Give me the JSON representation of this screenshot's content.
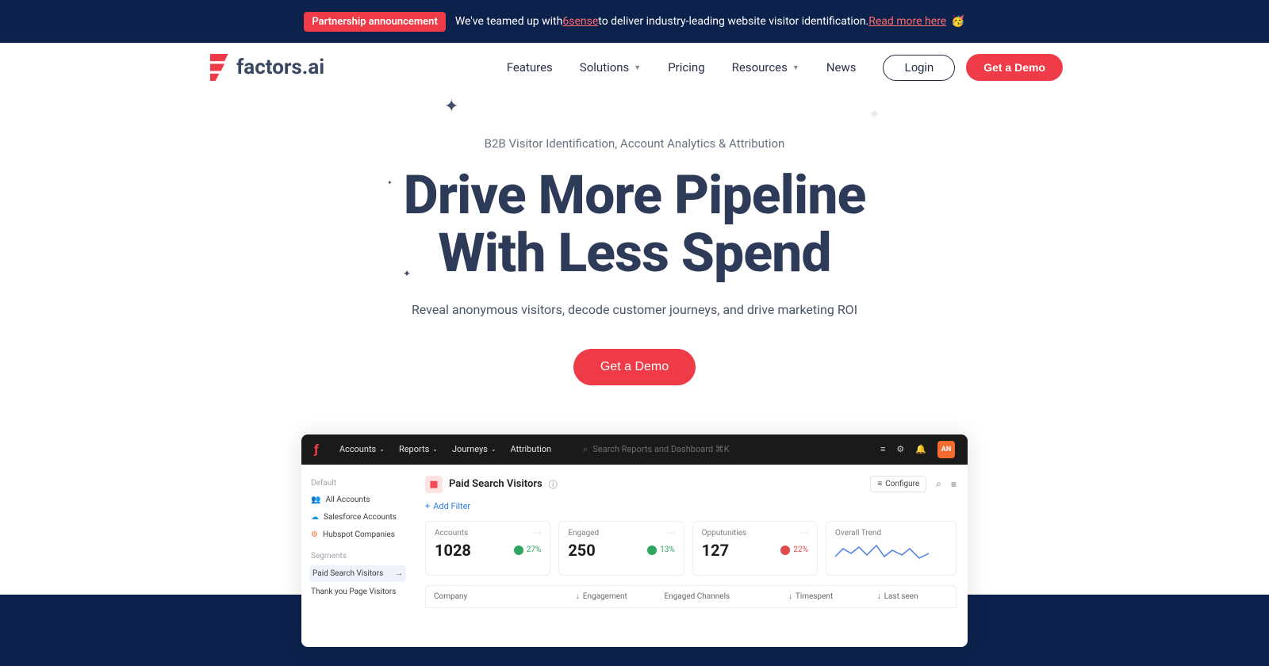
{
  "announcement": {
    "badge": "Partnership announcement",
    "text_pre": "We've teamed up with ",
    "partner": "6sense",
    "text_post": " to deliver industry-leading website visitor identification. ",
    "link": "Read more here",
    "emoji": "🥳"
  },
  "brand": "factors.ai",
  "nav": {
    "features": "Features",
    "solutions": "Solutions",
    "pricing": "Pricing",
    "resources": "Resources",
    "news": "News",
    "login": "Login",
    "demo": "Get a Demo"
  },
  "hero": {
    "eyebrow": "B2B Visitor Identification, Account Analytics & Attribution",
    "h1a": "Drive More Pipeline",
    "h1b": "With Less Spend",
    "sub": "Reveal anonymous visitors, decode customer journeys, and drive marketing ROI",
    "cta": "Get a Demo"
  },
  "app": {
    "menu": {
      "accounts": "Accounts",
      "reports": "Reports",
      "journeys": "Journeys",
      "attribution": "Attribution"
    },
    "search_placeholder": "Search Reports and Dashboard ⌘K",
    "avatar": "AN",
    "sidebar": {
      "group1": "Default",
      "items1": {
        "all": "All Accounts",
        "sf": "Salesforce Accounts",
        "hs": "Hubspot Companies"
      },
      "group2": "Segments",
      "items2": {
        "paid": "Paid Search Visitors",
        "thank": "Thank you Page Visitors"
      }
    },
    "title": "Paid Search Visitors",
    "configure": "Configure",
    "add_filter": "Add Filter",
    "cards": [
      {
        "label": "Accounts",
        "value": "1028",
        "pct": "27%",
        "up": true
      },
      {
        "label": "Engaged",
        "value": "250",
        "pct": "13%",
        "up": true
      },
      {
        "label": "Opputunities",
        "value": "127",
        "pct": "22%",
        "up": false
      }
    ],
    "trend_label": "Overall Trend",
    "table": {
      "c1": "Company",
      "c2": "Engagement",
      "c3": "Engaged Channels",
      "c4": "Timespent",
      "c5": "Last seen"
    }
  }
}
